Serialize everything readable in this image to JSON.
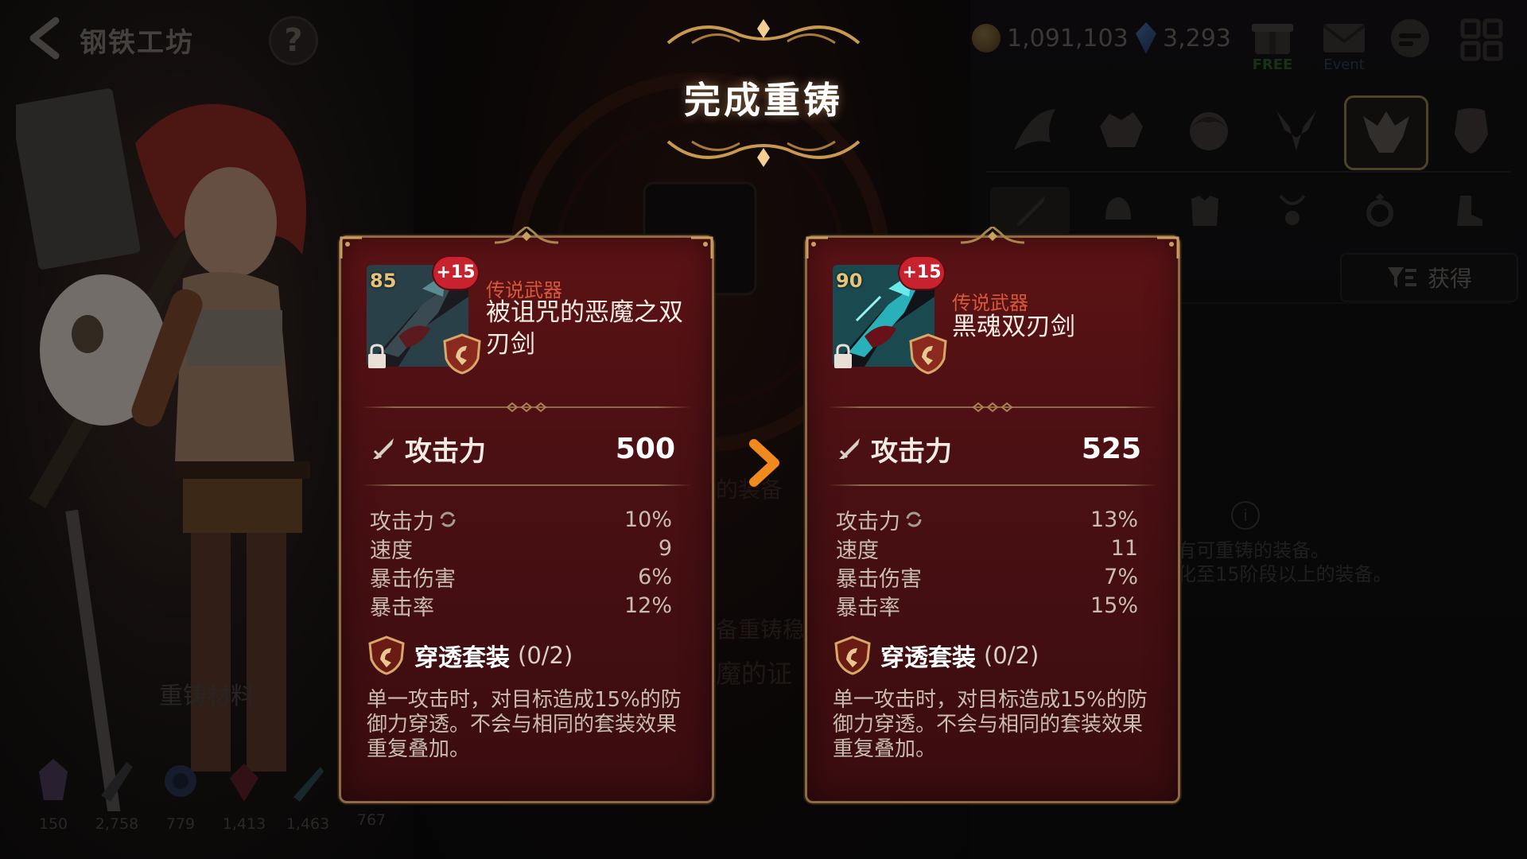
{
  "header": {
    "title": "钢铁工坊",
    "help_label": "?",
    "gold": "1,091,103",
    "gems": "3,293",
    "free_label": "FREE",
    "event_label": "Event"
  },
  "banner": {
    "title": "完成重铸"
  },
  "background": {
    "sort_label": "获得",
    "faded_mid_1": "的装备",
    "faded_mid_2": "备重铸稳",
    "faded_mid_3": "魔的证",
    "hint_1": "有可重铸的装备。",
    "hint_2": "化至15阶段以上的装备。",
    "materials_title": "重铸材料",
    "materials": [
      "150",
      "2,758",
      "779",
      "1,413",
      "1,463",
      "767"
    ]
  },
  "before": {
    "level": "85",
    "plus": "+15",
    "rarity": "传说武器",
    "name": "被诅咒的恶魔之双刃剑",
    "main_stat_label": "攻击力",
    "main_stat_value": "500",
    "sub_stats": [
      {
        "label": "攻击力",
        "value": "10%"
      },
      {
        "label": "速度",
        "value": "9"
      },
      {
        "label": "暴击伤害",
        "value": "6%"
      },
      {
        "label": "暴击率",
        "value": "12%"
      }
    ],
    "set_name": "穿透套装",
    "set_count": "(0/2)",
    "set_desc": "单一攻击时，对目标造成15%的防御力穿透。不会与相同的套装效果重复叠加。"
  },
  "after": {
    "level": "90",
    "plus": "+15",
    "rarity": "传说武器",
    "name": "黑魂双刃剑",
    "main_stat_label": "攻击力",
    "main_stat_value": "525",
    "sub_stats": [
      {
        "label": "攻击力",
        "value": "13%"
      },
      {
        "label": "速度",
        "value": "11"
      },
      {
        "label": "暴击伤害",
        "value": "7%"
      },
      {
        "label": "暴击率",
        "value": "15%"
      }
    ],
    "set_name": "穿透套装",
    "set_count": "(0/2)",
    "set_desc": "单一攻击时，对目标造成15%的防御力穿透。不会与相同的套装效果重复叠加。"
  },
  "colors": {
    "card_bg": "#4a1013",
    "card_border": "#8b6a44",
    "rarity": "#d65a3a",
    "plus_badge": "#c8222e",
    "arrow": "#f08a1c"
  }
}
